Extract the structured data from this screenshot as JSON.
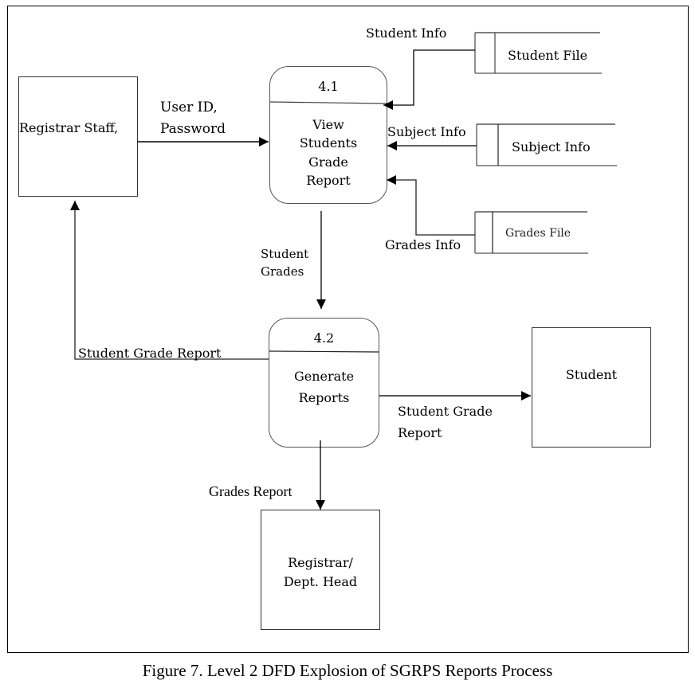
{
  "figure": {
    "caption": "Figure 7.  Level 2 DFD Explosion of SGRPS Reports Process"
  },
  "entities": {
    "registrar_staff": "Registrar Staff,",
    "student": "Student",
    "registrar_dept_head_line1": "Registrar/",
    "registrar_dept_head_line2": "Dept. Head"
  },
  "processes": {
    "p41": {
      "id": "4.1",
      "line1": "View",
      "line2": "Students",
      "line3": "Grade",
      "line4": "Report"
    },
    "p42": {
      "id": "4.2",
      "line1": "Generate",
      "line2": "Reports"
    }
  },
  "data_stores": {
    "student_file": "Student File",
    "subject_info": "Subject Info",
    "grades_file": "Grades File"
  },
  "flows": {
    "user_id_line1": "User ID,",
    "user_id_line2": "Password",
    "student_info": "Student Info",
    "subject_info": "Subject Info",
    "grades_info": "Grades Info",
    "student_grades_line1": "Student",
    "student_grades_line2": "Grades",
    "student_grade_report_left": "Student Grade Report",
    "student_grade_report_right_line1": "Student Grade",
    "student_grade_report_right_line2": "Report",
    "grades_report": "Grades Report"
  }
}
